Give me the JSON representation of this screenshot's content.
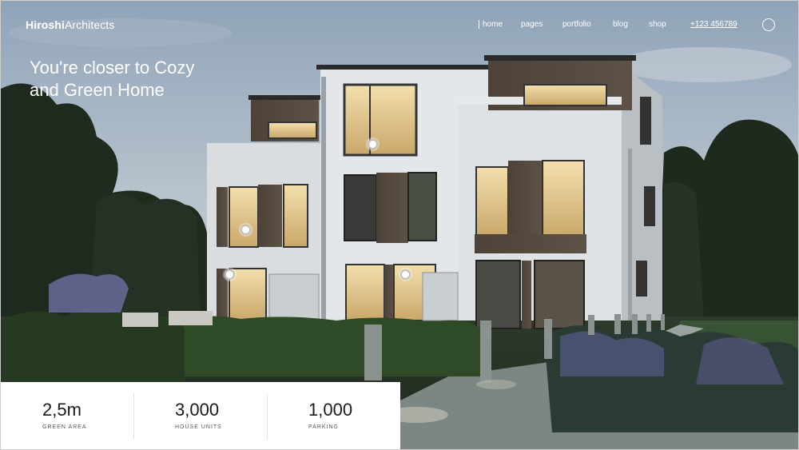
{
  "brand": {
    "bold": "Hiroshi",
    "light": "Architects"
  },
  "nav": {
    "items": [
      "home",
      "pages",
      "portfolio",
      "blog",
      "shop"
    ],
    "phone": "+123 456789"
  },
  "hero": {
    "line1": "You're closer to Cozy",
    "line2": "and Green Home"
  },
  "stats": [
    {
      "value": "2,5m",
      "label": "GREEN AREA"
    },
    {
      "value": "3,000",
      "label": "HOUSE UNITS"
    },
    {
      "value": "1,000",
      "label": "PARKING"
    }
  ],
  "icons": {
    "search": "search-circle-icon",
    "hotspot": "hotspot-dot-icon"
  },
  "colors": {
    "accent": "#ffffff",
    "stats_bg": "#ffffff"
  }
}
